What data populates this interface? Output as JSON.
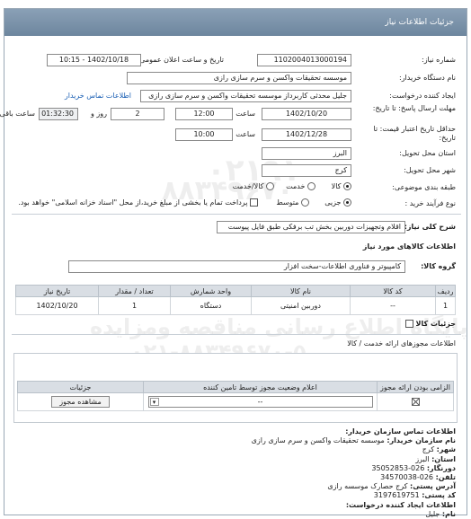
{
  "header": {
    "title": "جزئیات اطلاعات نیاز"
  },
  "fields": {
    "need_number_label": "شماره نیاز:",
    "need_number": "1102004013000194",
    "announce_label": "تاریخ و ساعت اعلان عمومی:",
    "announce_value": "1402/10/18 - 10:15",
    "buyer_label": "نام دستگاه خریدار:",
    "buyer_value": "موسسه تحقیقات واکسن و سرم سازی رازی",
    "creator_label": "ایجاد کننده درخواست:",
    "creator_value": "جلیل محدثی کاربرداز موسسه تحقیقات واکسن و سرم سازی رازی",
    "buyer_contact_link": "اطلاعات تماس خریدار",
    "send_deadline_label": "مهلت ارسال پاسخ: تا تاریخ:",
    "send_deadline_date": "1402/10/20",
    "time_label": "ساعت",
    "send_deadline_time": "12:00",
    "days_value": "2",
    "days_label": "روز و",
    "remaining_time": "01:32:30",
    "remaining_label": "ساعت باقی مانده",
    "validity_label": "حداقل تاریخ اعتبار قیمت: تا تاریخ:",
    "validity_date": "1402/12/28",
    "validity_time": "10:00",
    "province_label": "استان محل تحویل:",
    "province_value": "البرز",
    "city_label": "شهر محل تحویل:",
    "city_value": "کرج",
    "category_label": "طبقه بندی موضوعی:",
    "category_options": [
      "کالا",
      "خدمت",
      "کالا/خدمت"
    ],
    "process_label": "نوع فرآیند خرید :",
    "process_options": [
      "جزیی",
      "متوسط"
    ],
    "payment_note": "پرداخت تمام یا بخشی از مبلغ خرید،از محل \"اسناد خزانه اسلامی\" خواهد بود."
  },
  "description": {
    "label": "شرح کلی نیاز:",
    "value": "اقلام وتجهیزات دوربین بخش تب برفکی طبق فایل پیوست"
  },
  "goods": {
    "section_title": "اطلاعات کالاهای مورد نیاز",
    "group_label": "گروه کالا:",
    "group_value": "کامپیوتر و فناوری اطلاعات-سخت افزار",
    "columns": [
      "ردیف",
      "کد کالا",
      "نام کالا",
      "واحد شمارش",
      "تعداد / مقدار",
      "تاریخ نیاز"
    ],
    "rows": [
      [
        "1",
        "--",
        "دوربین امنیتی",
        "دستگاه",
        "1",
        "1402/10/20"
      ]
    ],
    "details_checkbox_label": "جزئیات کالا"
  },
  "permits": {
    "section_title": "اطلاعات مجوزهای ارائه خدمت / کالا",
    "columns": [
      "الزامی بودن ارائه مجوز",
      "اعلام وضعیت مجوز توسط تامین کننده",
      "جزئیات"
    ],
    "select_value": "--",
    "view_button": "مشاهده مجوز"
  },
  "contact": {
    "title": "اطلاعات تماس سازمان خریدار:",
    "lines": [
      {
        "label": "نام سازمان خریدار:",
        "value": " موسسه تحقیقات واکسن و سرم سازی رازی"
      },
      {
        "label": "شهر:",
        "value": " کرج"
      },
      {
        "label": "استان:",
        "value": " البرز"
      },
      {
        "label": "دورنگار:",
        "value": " 026-35052853"
      },
      {
        "label": "تلفن:",
        "value": " 026-34570038"
      },
      {
        "label": "آدرس پستی:",
        "value": " کرج حصارک موسسه رازی"
      },
      {
        "label": "کد پستی:",
        "value": " 3197619751"
      },
      {
        "label": "اطلاعات ایجاد کننده درخواست:",
        "value": ""
      },
      {
        "label": "نام:",
        "value": " جلیل"
      }
    ]
  },
  "watermark": {
    "line1": "پایگاه اطلاع رسانی مناقصه ومزایده",
    "line2": "۰۲۱-۸۸۳۴۹۶۷۰-۵",
    "line3": "۸۸۳۴۹۶۷۰",
    "line4": "۰۲۱۹۱"
  },
  "colors": {
    "header": "#7890a8",
    "link": "#1a5fb4"
  }
}
